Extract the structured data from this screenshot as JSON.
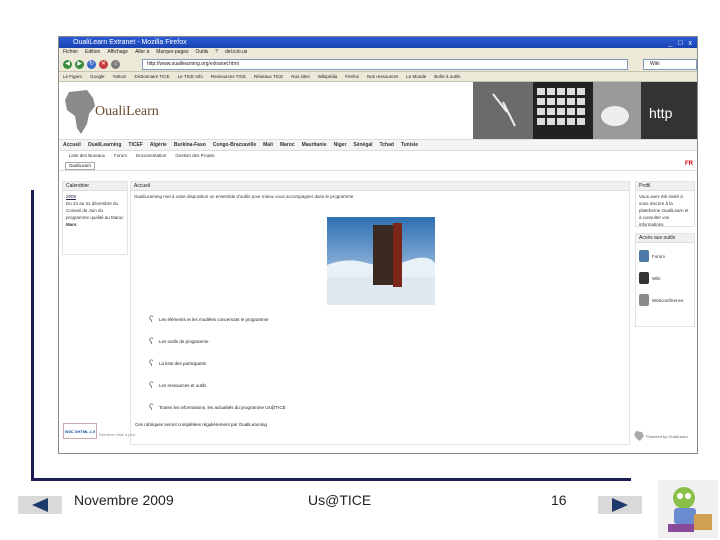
{
  "browser": {
    "title": "OualiLearn Extranet - Mozilla Firefox",
    "window_controls": "_ □ x",
    "menu": [
      "Fichier",
      "Edition",
      "Affichage",
      "Aller à",
      "Marque-pages",
      "Outils",
      "?",
      "del.icio.us"
    ],
    "url": "http://www.oualilearning.org/extranet.html",
    "search_placeholder": "Wiki",
    "bookmarks": [
      "Le Figaro",
      "Google",
      "Yahoo!",
      "Dictionnaire TICE",
      "Le TICE Info",
      "Ressources TICE",
      "Réseaux TICE",
      "Nos sites",
      "Wikipédia",
      "Firefox",
      "Nos ressources",
      "Le Monde",
      "Boîte à outils"
    ]
  },
  "site": {
    "logo_text": "OualiLearn",
    "nav": [
      "Accueil",
      "OualiLearning",
      "TICEF",
      "Algérie",
      "Burkina-Faso",
      "Congo-Brazzaville",
      "Mali",
      "Maroc",
      "Mauritanie",
      "Niger",
      "Sénégal",
      "Tchad",
      "Tunisie"
    ],
    "subnav": [
      "Liste des Bureaux",
      "Forum",
      "Documentation",
      "Gestion des Projets"
    ],
    "breadcrumb": "OualiLearn",
    "lang_flag": "FR",
    "left_panel": {
      "title": "Calendrier",
      "date_label": "2009",
      "body": "Du 24 au 31 décembre du Conseil de Juin du programme qualité au Maroc",
      "footer": "Mars"
    },
    "center_panel": {
      "title": "Accueil",
      "intro": "OualiLearning met à votre disposition un ensemble d'outils pour mieux vous accompagner dans le programme",
      "items": [
        "Les éléments et les modèles concernant le programme",
        "Les outils de programme",
        "La liste des participants",
        "Les ressources et outils",
        "Toutes les informations, les actualités du programme Us@TICE"
      ],
      "conclusion": "Ces rubriques seront complétées régulièrement par OualiLearning",
      "footer_badge": "W3C XHTML 1.0",
      "footer_note": "Dernière mise à jour",
      "credit": "Powered by OualiLearn"
    },
    "right_panel": {
      "title": "Profil",
      "body": "Vous avez été invité à vous inscrire à la plateforme OualiLearn et à consulter vos informations",
      "section2_title": "Accès aux outils",
      "tools": [
        "Forum",
        "Wiki",
        "Webconférence"
      ]
    }
  },
  "slide": {
    "date": "Novembre 2009",
    "center": "Us@TICE",
    "page": "16"
  },
  "colors": {
    "frame": "#1d1d55",
    "titlebar": "#1943b0",
    "arrow": "#1e3b6e"
  }
}
